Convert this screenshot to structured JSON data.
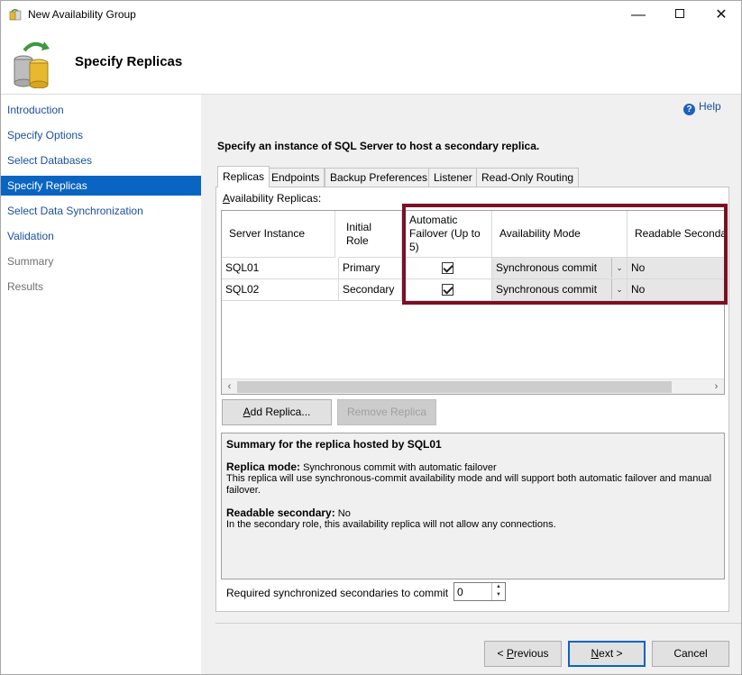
{
  "window": {
    "title": "New Availability Group",
    "header_title": "Specify Replicas"
  },
  "sidebar": {
    "items": [
      {
        "label": "Introduction",
        "state": "link"
      },
      {
        "label": "Specify Options",
        "state": "link"
      },
      {
        "label": "Select Databases",
        "state": "link"
      },
      {
        "label": "Specify Replicas",
        "state": "active"
      },
      {
        "label": "Select Data Synchronization",
        "state": "link"
      },
      {
        "label": "Validation",
        "state": "link"
      },
      {
        "label": "Summary",
        "state": "disabled"
      },
      {
        "label": "Results",
        "state": "disabled"
      }
    ]
  },
  "help": {
    "label": "Help"
  },
  "main": {
    "instruction": "Specify an instance of SQL Server to host a secondary replica.",
    "tabs": [
      {
        "label": "Replicas",
        "active": true
      },
      {
        "label": "Endpoints",
        "active": false
      },
      {
        "label": "Backup Preferences",
        "active": false
      },
      {
        "label": "Listener",
        "active": false
      },
      {
        "label": "Read-Only Routing",
        "active": false
      }
    ],
    "section_label_prefix": "A",
    "section_label_rest": "vailability Replicas:",
    "table": {
      "headers": {
        "server_instance": "Server Instance",
        "initial_role": "Initial Role",
        "automatic_failover": "Automatic Failover (Up to 5)",
        "availability_mode": "Availability Mode",
        "readable_secondary": "Readable Secondar"
      },
      "rows": [
        {
          "server_instance": "SQL01",
          "initial_role": "Primary",
          "automatic_failover": true,
          "availability_mode": "Synchronous commit",
          "readable_secondary": "No"
        },
        {
          "server_instance": "SQL02",
          "initial_role": "Secondary",
          "automatic_failover": true,
          "availability_mode": "Synchronous commit",
          "readable_secondary": "No"
        }
      ]
    },
    "add_replica": {
      "u": "A",
      "rest": "dd Replica..."
    },
    "remove_replica": {
      "label": "Remove Replica"
    },
    "summary": {
      "title": "Summary for the replica hosted by SQL01",
      "replica_mode_label": "Replica mode:",
      "replica_mode_value": " Synchronous commit with automatic failover",
      "replica_mode_desc": "This replica will use synchronous-commit availability mode and will support both automatic failover and manual failover.",
      "readable_label": "Readable secondary:",
      "readable_value": " No",
      "readable_desc": "In the secondary role, this availability replica will not allow any connections."
    },
    "required_sync": {
      "label": "Required synchronized secondaries to commit",
      "value": "0"
    }
  },
  "footer": {
    "previous": {
      "prefix": "< ",
      "u": "P",
      "rest": "revious"
    },
    "next": {
      "u": "N",
      "rest": "ext >"
    },
    "cancel": {
      "label": "Cancel"
    }
  },
  "colors": {
    "accent": "#0a64c2",
    "link": "#1a4f9c",
    "highlight_border": "#7b1024"
  }
}
